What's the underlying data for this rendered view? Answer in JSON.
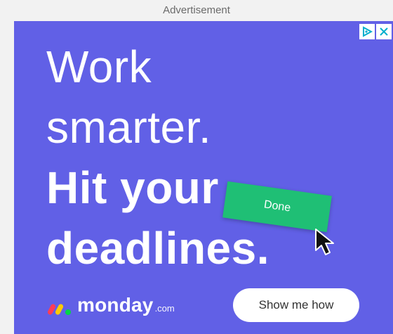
{
  "ad": {
    "label": "Advertisement",
    "headline": {
      "line1": "Work",
      "line2": "smarter.",
      "line3": "Hit your",
      "line4": "deadlines."
    },
    "task_chip": "Done",
    "brand": {
      "name": "monday",
      "tld": ".com"
    },
    "cta": "Show me how",
    "adchoices": {
      "info_icon": "adchoices-triangle-icon",
      "close_icon": "close-icon"
    },
    "colors": {
      "background": "#6160e6",
      "chip": "#1fbf75",
      "text": "#ffffff",
      "cta_bg": "#ffffff"
    }
  }
}
